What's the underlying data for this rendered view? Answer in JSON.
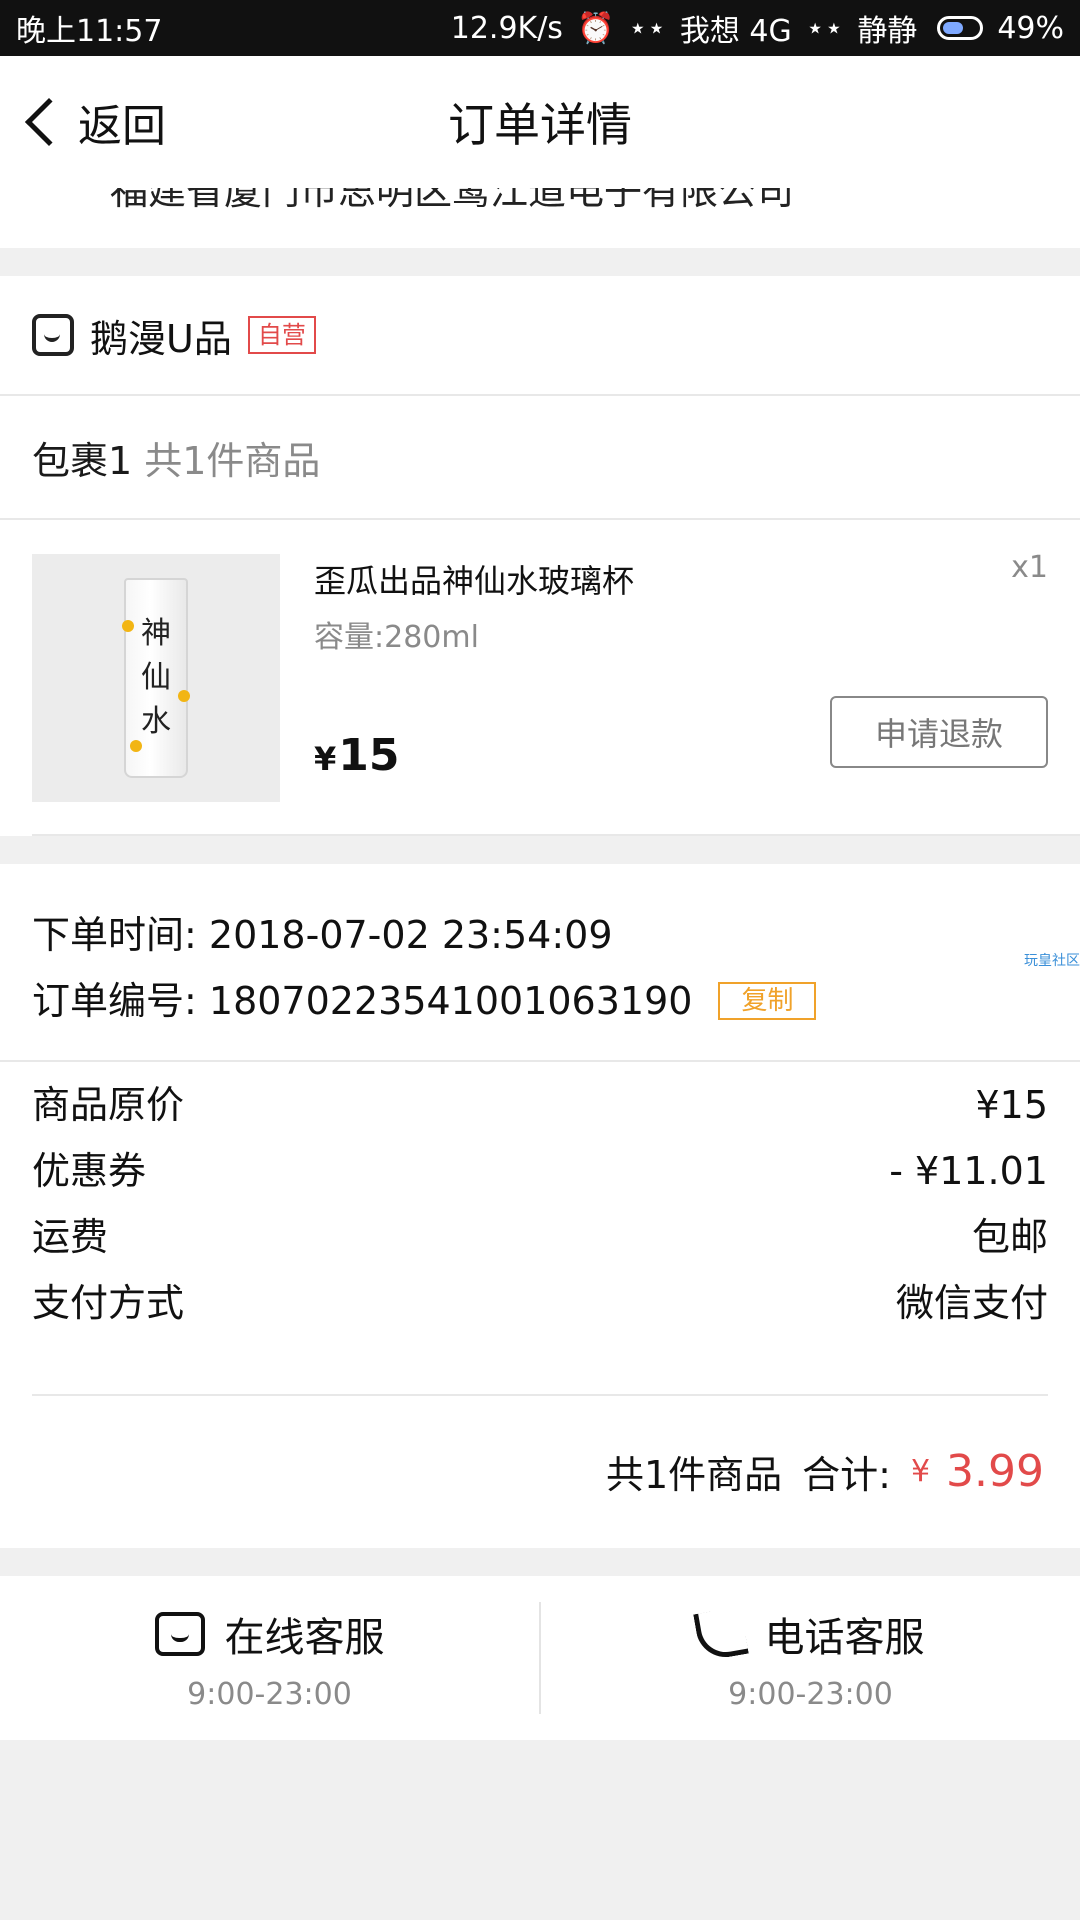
{
  "status_bar": {
    "time": "晚上11:57",
    "speed": "12.9K/s",
    "carrier": "我想 4G",
    "mode": "静静",
    "battery": "49%"
  },
  "nav": {
    "back_label": "返回",
    "title": "订单详情"
  },
  "address_cut_text": "福建省厦门市思明区鹭江道电子有限公司",
  "shop": {
    "name": "鹅漫U品",
    "tag": "自营",
    "package_label": "包裹1",
    "package_count": "共1件商品"
  },
  "item": {
    "title": "歪瓜出品神仙水玻璃杯",
    "spec": "容量:280ml",
    "qty": "x1",
    "price_symbol": "¥",
    "price": "15",
    "refund_button": "申请退款",
    "image_text": [
      "神",
      "仙",
      "水"
    ]
  },
  "order": {
    "time_label": "下单时间:",
    "time_value": "2018-07-02 23:54:09",
    "id_label": "订单编号:",
    "id_value": "18070223541001063190",
    "copy_button": "复制",
    "watermark": "玩皇社区"
  },
  "pricing": [
    {
      "label": "商品原价",
      "value": "¥15"
    },
    {
      "label": "优惠券",
      "value": "- ¥11.01"
    },
    {
      "label": "运费",
      "value": "包邮"
    },
    {
      "label": "支付方式",
      "value": "微信支付"
    }
  ],
  "total": {
    "count_text": "共1件商品",
    "label": "合计:",
    "symbol": "¥",
    "amount": "3.99"
  },
  "service": {
    "online": {
      "label": "在线客服",
      "hours": "9:00-23:00"
    },
    "phone": {
      "label": "电话客服",
      "hours": "9:00-23:00"
    }
  },
  "colors": {
    "accent_red": "#e24a4a",
    "accent_orange": "#f0a22a",
    "muted": "#8a8a8a"
  }
}
